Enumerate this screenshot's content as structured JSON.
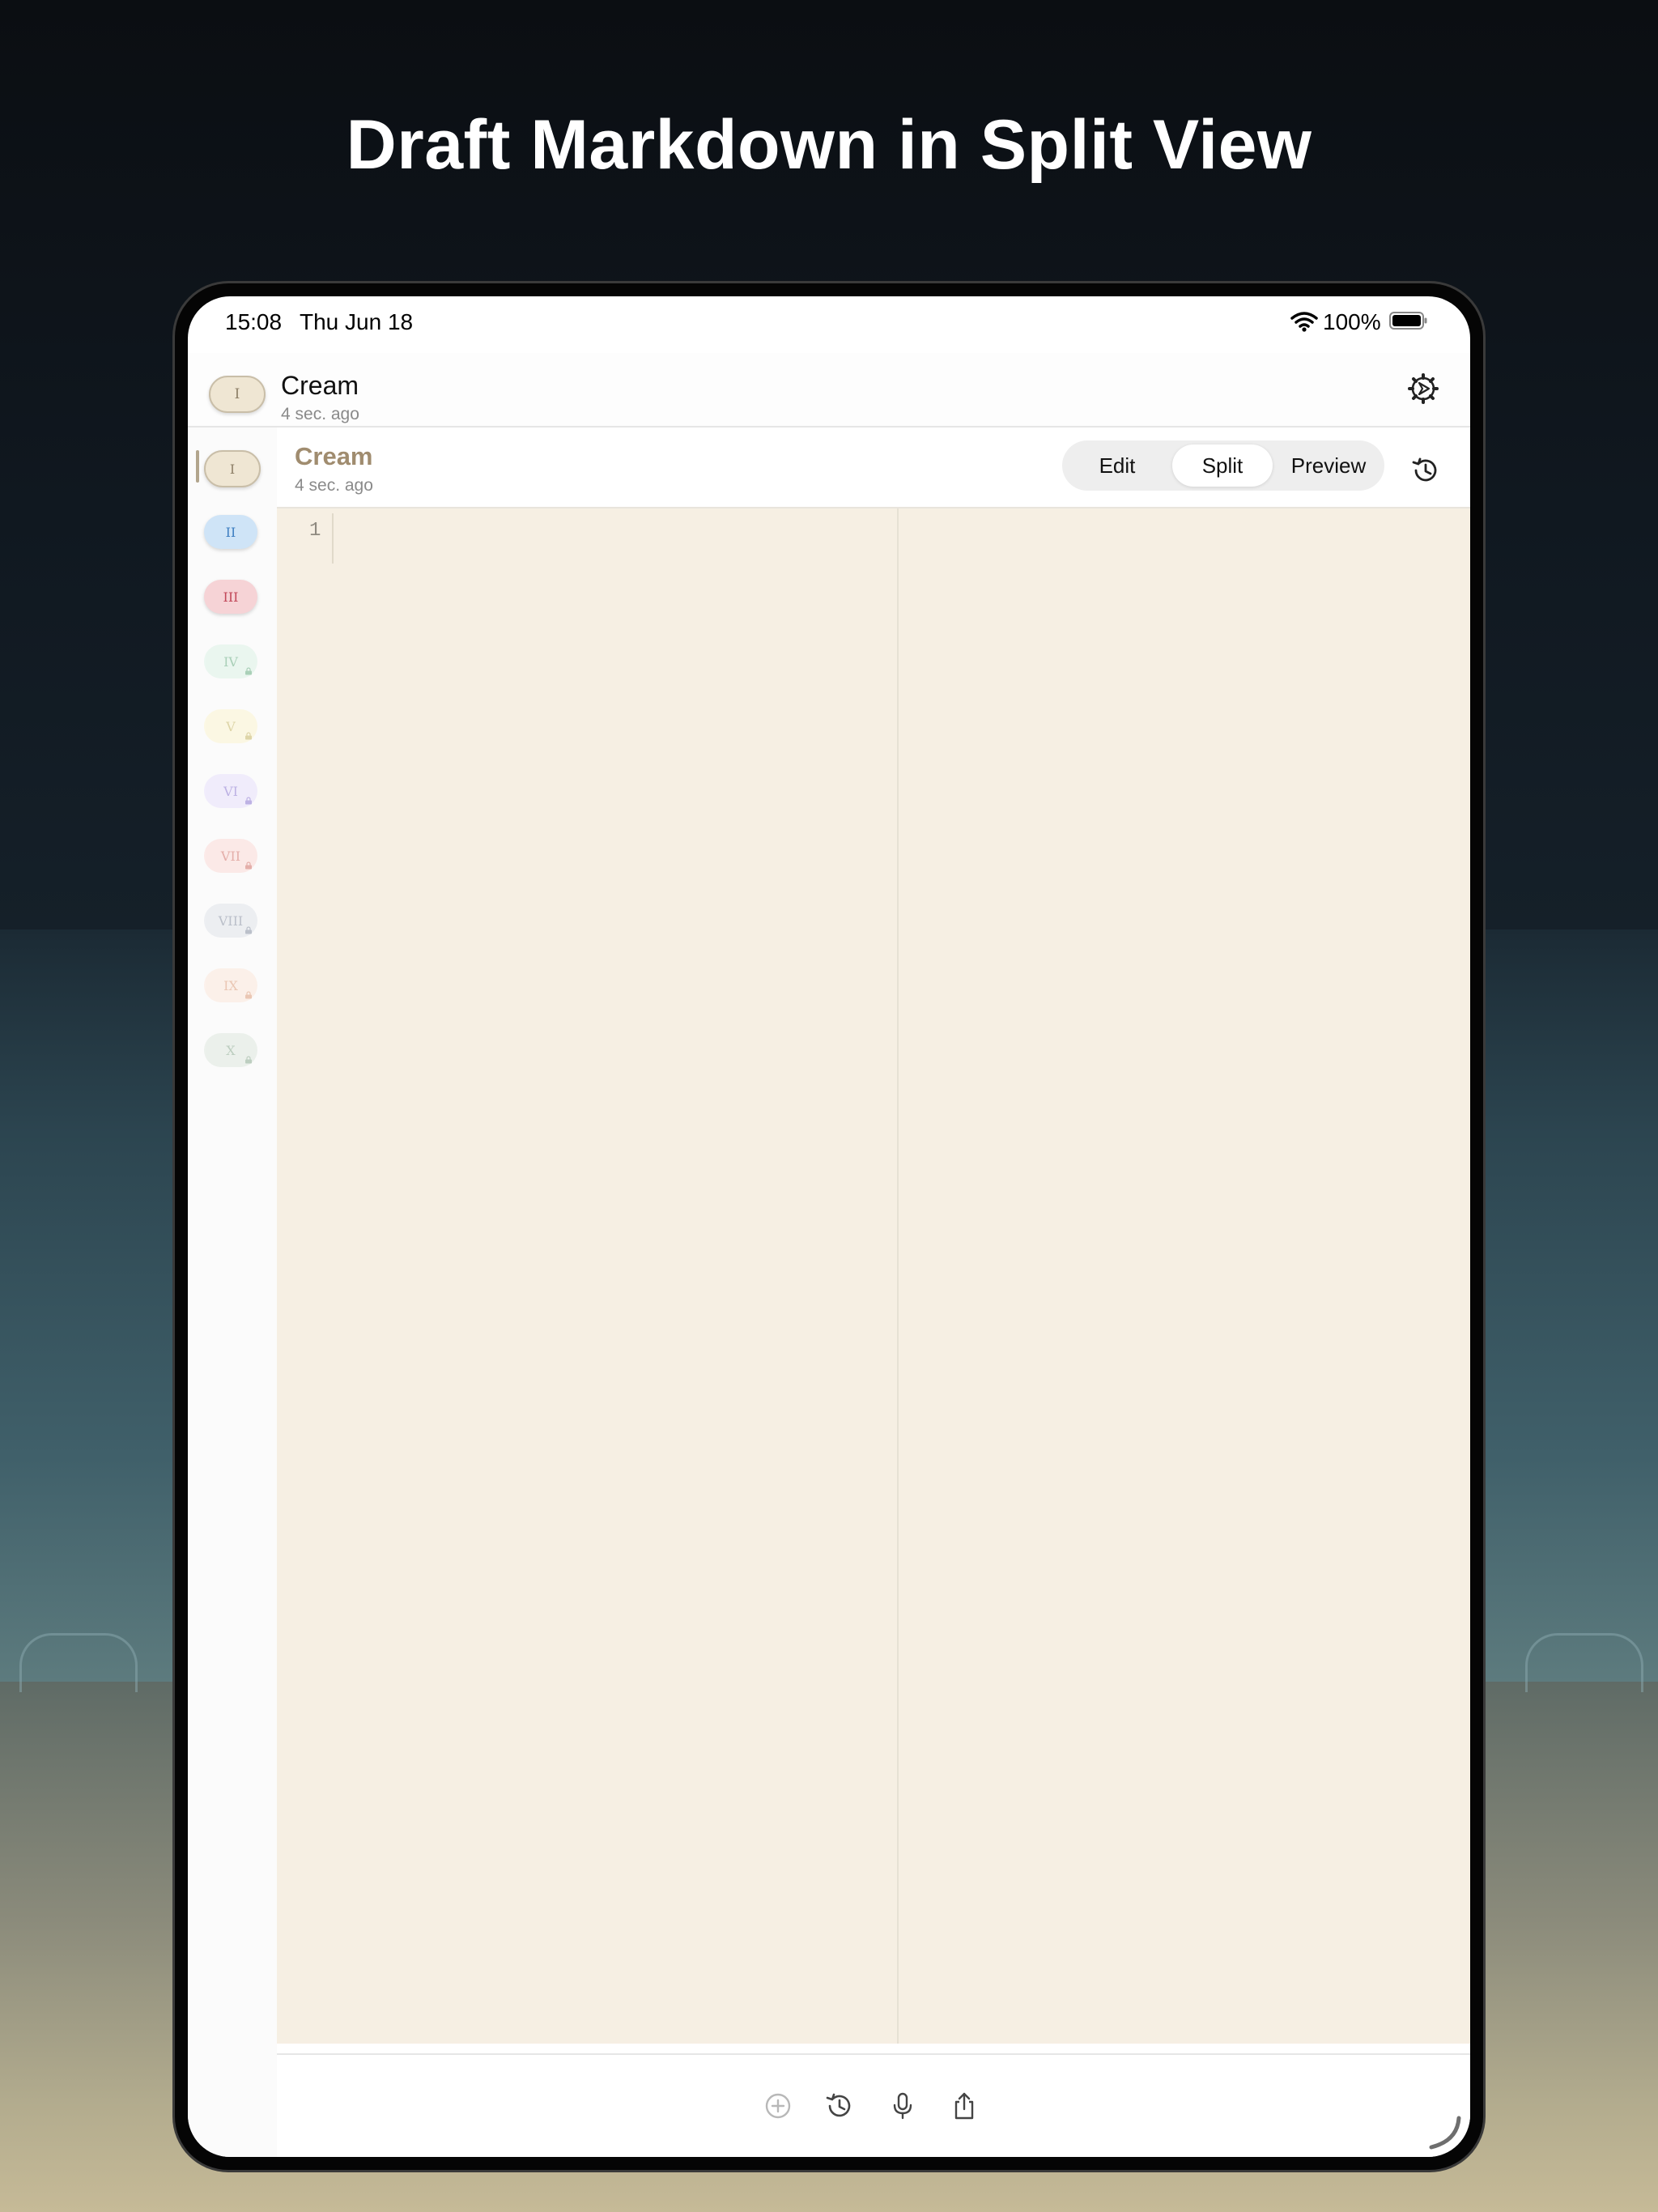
{
  "page": {
    "headline": "Draft Markdown in Split View"
  },
  "status_bar": {
    "time": "15:08",
    "date": "Thu Jun 18",
    "battery_percent": "100%",
    "icons": [
      "wifi-icon",
      "battery-icon"
    ]
  },
  "top_bar": {
    "badge": "I",
    "title": "Cream",
    "subtitle": "4 sec. ago",
    "icon": "settings-gear-icon"
  },
  "sidebar": {
    "items": [
      {
        "label": "I",
        "locked": false,
        "color": "#efe6d3"
      },
      {
        "label": "II",
        "locked": false,
        "color": "#cfe4f7"
      },
      {
        "label": "III",
        "locked": false,
        "color": "#f6d3d6"
      },
      {
        "label": "IV",
        "locked": true,
        "color": "#e8f6ee"
      },
      {
        "label": "V",
        "locked": true,
        "color": "#fbf7df"
      },
      {
        "label": "VI",
        "locked": true,
        "color": "#efeafb"
      },
      {
        "label": "VII",
        "locked": true,
        "color": "#fbe6e4"
      },
      {
        "label": "VIII",
        "locked": true,
        "color": "#eaecf0"
      },
      {
        "label": "IX",
        "locked": true,
        "color": "#fcefe7"
      },
      {
        "label": "X",
        "locked": true,
        "color": "#e9efe9"
      }
    ]
  },
  "document_bar": {
    "title": "Cream",
    "subtitle": "4 sec. ago",
    "modes": [
      "Edit",
      "Split",
      "Preview"
    ],
    "selected_mode": "Split",
    "icon": "history-icon"
  },
  "editor": {
    "line_numbers": [
      "1"
    ],
    "content": "",
    "background": "#f6efe3"
  },
  "bottom_toolbar": {
    "icons": [
      "add-circle-icon",
      "history-icon",
      "microphone-icon",
      "share-icon"
    ]
  }
}
